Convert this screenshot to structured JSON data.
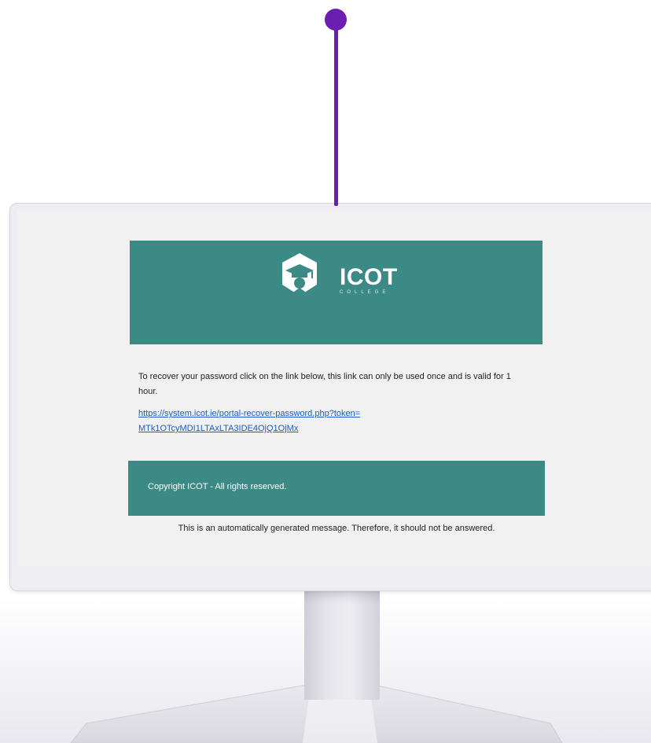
{
  "brand": {
    "name": "ICOT",
    "sub": "COLLEGE",
    "accent_color": "#3c8a86",
    "pin_color": "#6a1fb1"
  },
  "email": {
    "message": "To recover your password click on the link below, this link can only be used once and is valid for 1 hour.",
    "link_line1": "https://system.icot.ie/portal-recover-password.php?token=",
    "link_line2": "MTk1OTcyMDI1LTAxLTA3IDE4OjQ1OjMx",
    "footer": "Copyright ICOT - All rights reserved.",
    "notice": "This is an automatically generated message. Therefore, it should not be answered."
  },
  "icons": {
    "logo": "graduation-cap-hexagon-icon",
    "pin": "location-pin-icon"
  }
}
